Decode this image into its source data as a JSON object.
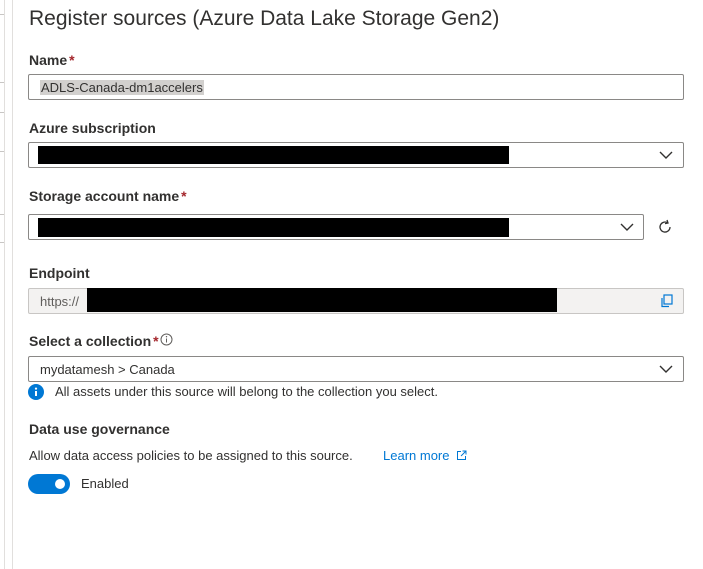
{
  "panel": {
    "title": "Register sources (Azure Data Lake Storage Gen2)"
  },
  "name_field": {
    "label": "Name",
    "required_mark": "*",
    "value": "ADLS-Canada-dm1accelers"
  },
  "subscription": {
    "label": "Azure subscription",
    "value": ""
  },
  "storage_account": {
    "label": "Storage account name",
    "required_mark": "*",
    "value": ""
  },
  "endpoint": {
    "label": "Endpoint",
    "value": "https://"
  },
  "collection": {
    "label": "Select a collection",
    "required_mark": "*",
    "value": "mydatamesh > Canada",
    "info": "All assets under this source will belong to the collection you select."
  },
  "governance": {
    "heading": "Data use governance",
    "description": "Allow data access policies to be assigned to this source.",
    "learn_more": "Learn more",
    "toggle_label": "Enabled",
    "enabled": true
  },
  "colors": {
    "accent": "#0078d4",
    "required": "#a4262c",
    "redaction": "#000000"
  },
  "icons": {
    "dropdown": "chevron-down-icon",
    "refresh": "refresh-icon",
    "copy": "copy-icon",
    "info": "info-icon",
    "external_link": "external-link-icon"
  }
}
